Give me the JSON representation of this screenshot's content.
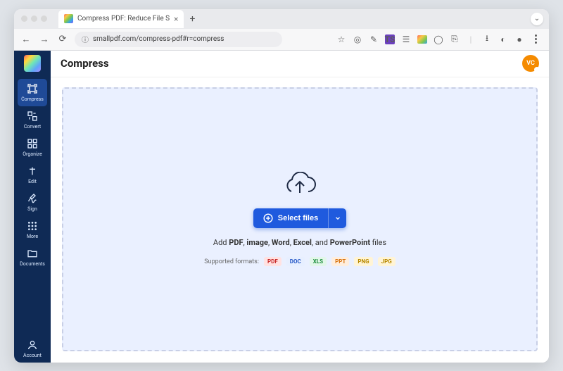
{
  "browser": {
    "tab_title": "Compress PDF: Reduce File S",
    "url": "smallpdf.com/compress-pdf#r=compress"
  },
  "header": {
    "title": "Compress",
    "avatar": "VC"
  },
  "sidebar": {
    "items": [
      {
        "label": "Compress"
      },
      {
        "label": "Convert"
      },
      {
        "label": "Organize"
      },
      {
        "label": "Edit"
      },
      {
        "label": "Sign"
      },
      {
        "label": "More"
      },
      {
        "label": "Documents"
      }
    ],
    "account_label": "Account"
  },
  "upload": {
    "button_label": "Select files",
    "subtext_prefix": "Add ",
    "subtext_b1": "PDF",
    "subtext_c1": ", ",
    "subtext_b2": "image",
    "subtext_c2": ", ",
    "subtext_b3": "Word",
    "subtext_c3": ", ",
    "subtext_b4": "Excel",
    "subtext_c4": ", and ",
    "subtext_b5": "PowerPoint",
    "subtext_suffix": " files",
    "formats_label": "Supported formats:",
    "formats": {
      "pdf": "PDF",
      "doc": "DOC",
      "xls": "XLS",
      "ppt": "PPT",
      "png": "PNG",
      "jpg": "JPG"
    }
  }
}
